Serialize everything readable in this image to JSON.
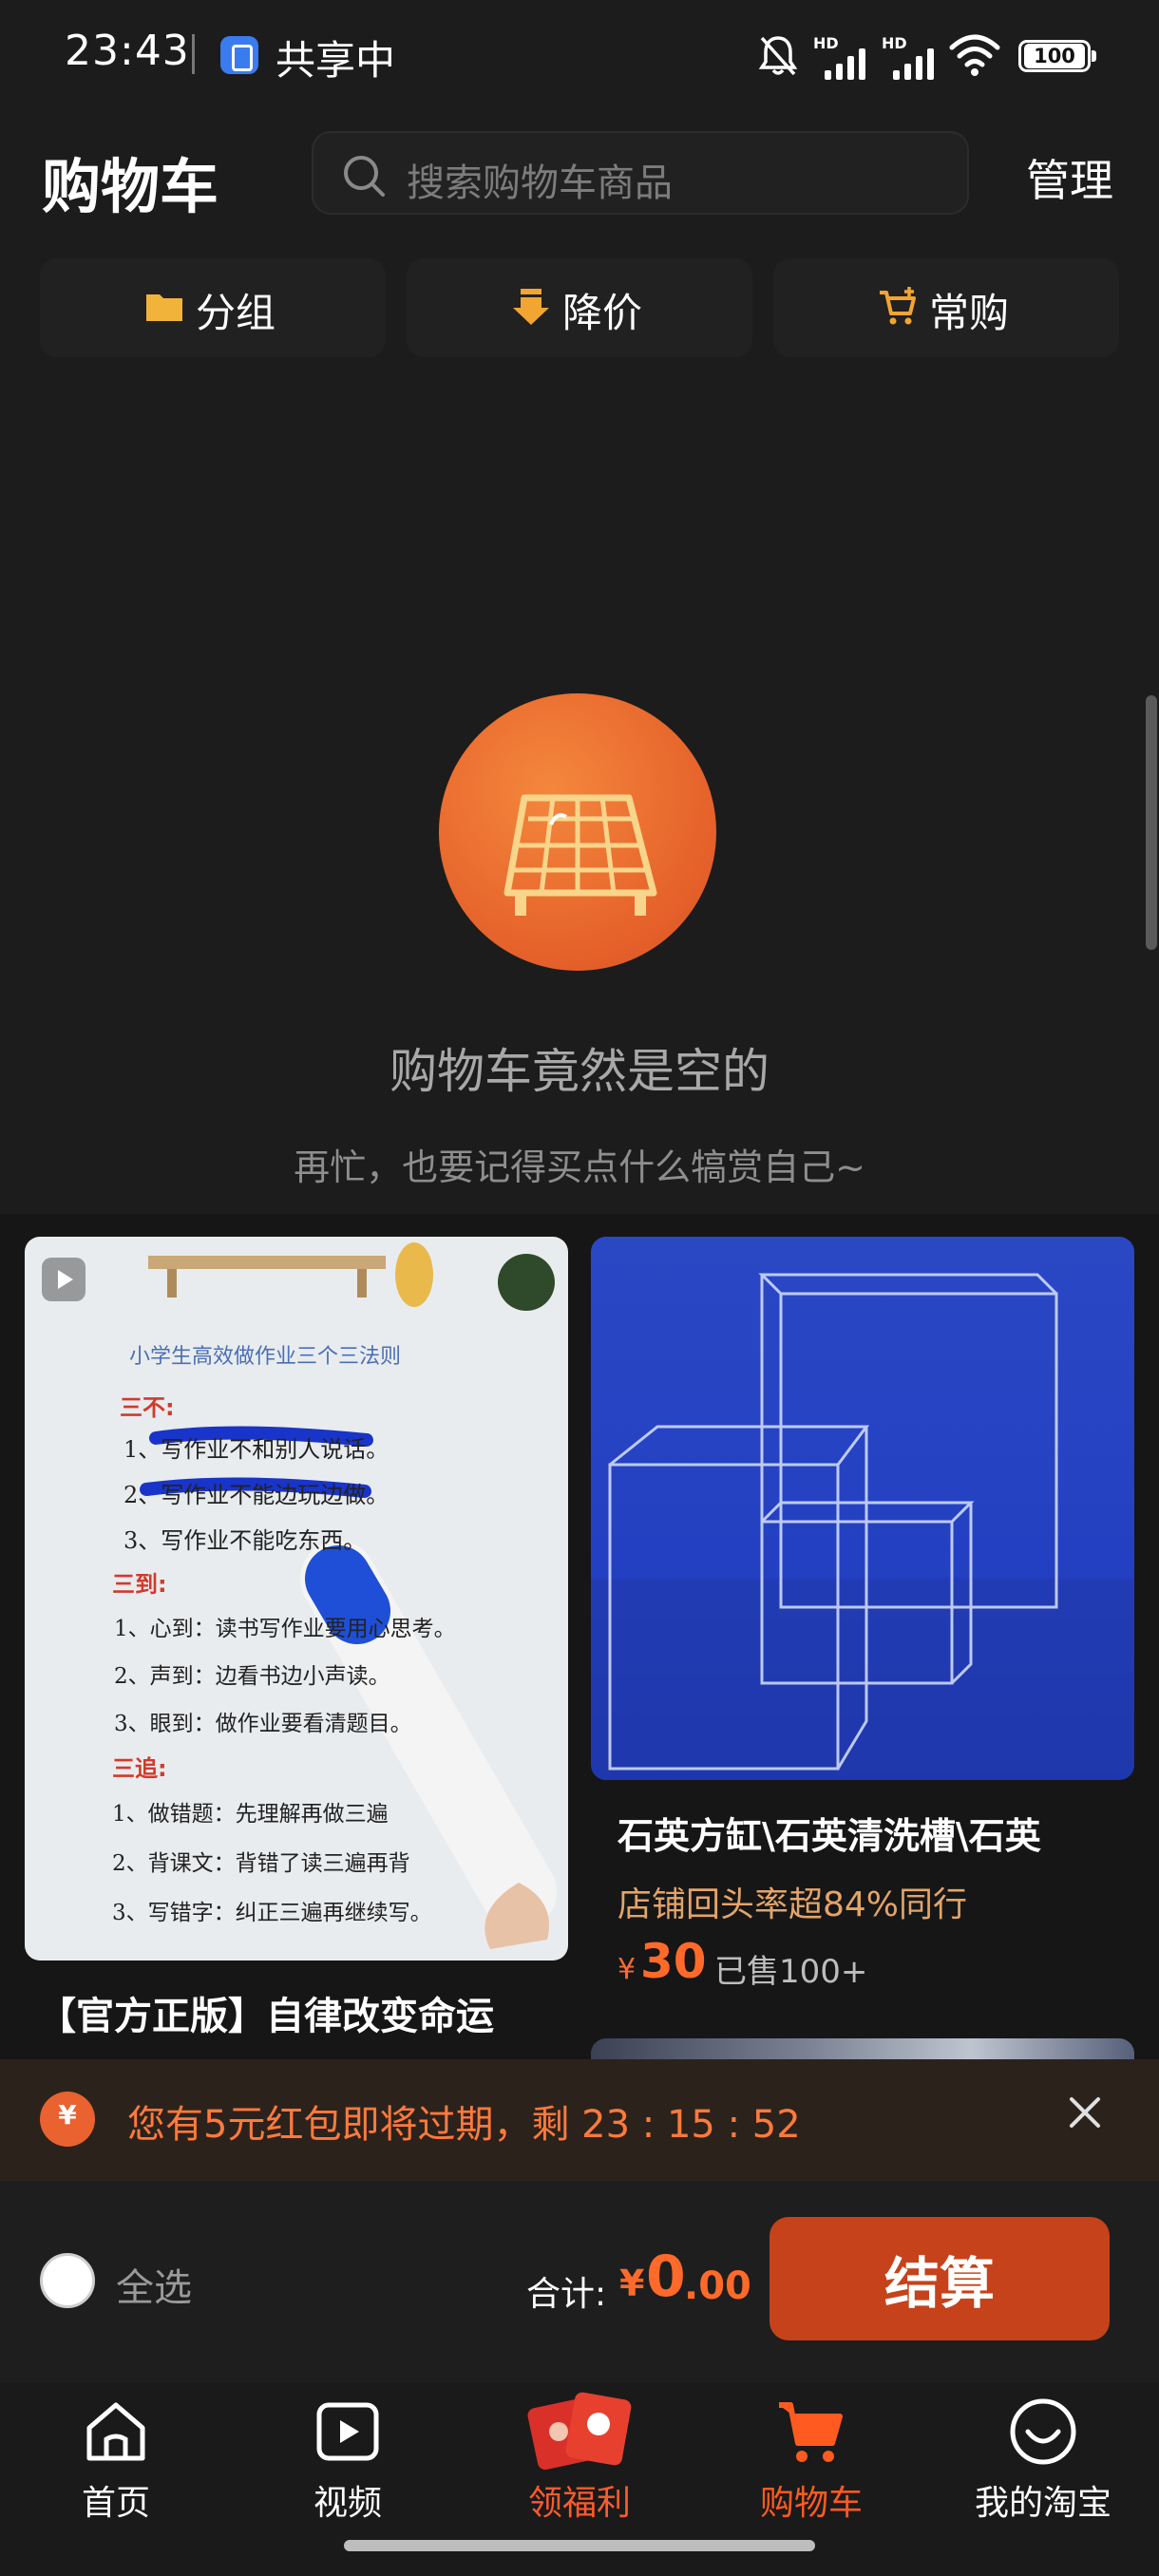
{
  "status_bar": {
    "time": "23:43",
    "sharing": "共享中",
    "battery": "100",
    "signal_label": "HD"
  },
  "header": {
    "title": "购物车",
    "search_placeholder": "搜索购物车商品",
    "manage": "管理"
  },
  "quick_tabs": [
    {
      "label": "分组",
      "icon": "folder-icon"
    },
    {
      "label": "降价",
      "icon": "price-drop-icon"
    },
    {
      "label": "常购",
      "icon": "cart-plus-icon"
    }
  ],
  "empty_state": {
    "title": "购物车竟然是空的",
    "subtitle": "再忙，也要记得买点什么犒赏自己~"
  },
  "products": [
    {
      "title": "【官方正版】自律改变命运",
      "image_text": {
        "heading": "小学生高效做作业三个三法则",
        "section1": "三不:",
        "s1_items": [
          "1、写作业不和别人说话。",
          "2、写作业不能边玩边做。",
          "3、写作业不能吃东西。"
        ],
        "section2": "三到:",
        "s2_items": [
          "1、心到：读书写作业要用心思考。",
          "2、声到：边看书边小声读。",
          "3、眼到：做作业要看清题目。"
        ],
        "section3": "三追:",
        "s3_items": [
          "1、做错题：先理解再做三遍",
          "2、背课文：背错了读三遍再背",
          "3、写错字：纠正三遍再继续写。"
        ]
      }
    },
    {
      "title": "石英方缸\\石英清洗槽\\石英",
      "tag": "店铺回头率超84%同行",
      "price_symbol": "¥",
      "price": "30",
      "sold": "已售100+"
    }
  ],
  "banner": {
    "text": "您有5元红包即将过期，剩 23 : 15 : 52"
  },
  "checkout": {
    "select_all": "全选",
    "total_label": "合计:",
    "currency": "¥",
    "total_int": "0",
    "total_dec": ".00",
    "pay_button": "结算"
  },
  "bottom_nav": [
    {
      "label": "首页",
      "icon": "home-icon",
      "active": false
    },
    {
      "label": "视频",
      "icon": "video-icon",
      "active": false
    },
    {
      "label": "领福利",
      "icon": "red-packet-icon",
      "active": false
    },
    {
      "label": "购物车",
      "icon": "cart-icon",
      "active": true
    },
    {
      "label": "我的淘宝",
      "icon": "smile-icon",
      "active": false
    }
  ],
  "colors": {
    "accent": "#ff6a2a",
    "pay_button": "#c6421a",
    "background": "#1c1c1c"
  }
}
